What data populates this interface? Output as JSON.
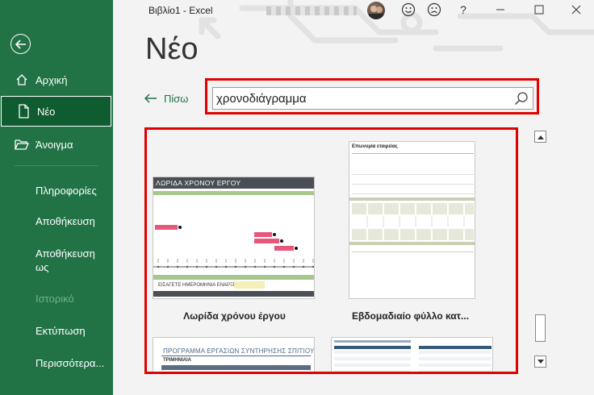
{
  "window": {
    "title": "Βιβλίο1  -  Excel",
    "help": "?"
  },
  "sidebar": {
    "home": "Αρχική",
    "new": "Νέο",
    "open": "Άνοιγμα",
    "info": "Πληροφορίες",
    "save": "Αποθήκευση",
    "save_as_1": "Αποθήκευση",
    "save_as_2": "ως",
    "history": "Ιστορικό",
    "print": "Εκτύπωση",
    "more": "Περισσότερα..."
  },
  "main": {
    "title": "Νέο",
    "back": "Πίσω",
    "search_value": "χρονοδιάγραμμα"
  },
  "templates": [
    {
      "name": "Λωρίδα χρόνου έργου",
      "header": "ΛΩΡΙΔΑ ΧΡΟΝΟΥ ΕΡΓΟΥ",
      "start_label": "ΕΙΣΑΓΕΤΕ ΗΜΕΡΟΜΗΝΙΑ ΕΝΑΡΞΗΣ:"
    },
    {
      "name": "Εβδομαδιαίο φύλλο κατ...",
      "header": "Επωνυμία εταιρείας"
    },
    {
      "name": "",
      "header": "ΠΡΟΓΡΑΜΜΑ ΕΡΓΑΣΙΩΝ ΣΥΝΤΗΡΗΣΗΣ ΣΠΙΤΙΟΥ",
      "sub": "ΤΡΙΜΗΝΙΑΙΑ"
    },
    {
      "name": ""
    }
  ],
  "colors": {
    "sidebar": "#217346",
    "highlight": "#e00000"
  }
}
